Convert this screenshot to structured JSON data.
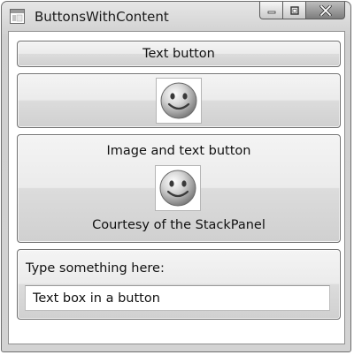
{
  "window": {
    "title": "ButtonsWithContent",
    "app_icon": "window-app-icon",
    "caption_buttons": [
      "minimize-icon",
      "maximize-icon",
      "close-icon"
    ]
  },
  "buttons": {
    "text_button": {
      "label": "Text button"
    },
    "image_button": {
      "icon": "smiley-face-icon"
    },
    "combo_button": {
      "top_label": "Image and text button",
      "icon": "smiley-face-icon",
      "bottom_label": "Courtesy of the StackPanel"
    },
    "textbox_button": {
      "label": "Type something here:",
      "input_value": "Text box in a button"
    }
  }
}
